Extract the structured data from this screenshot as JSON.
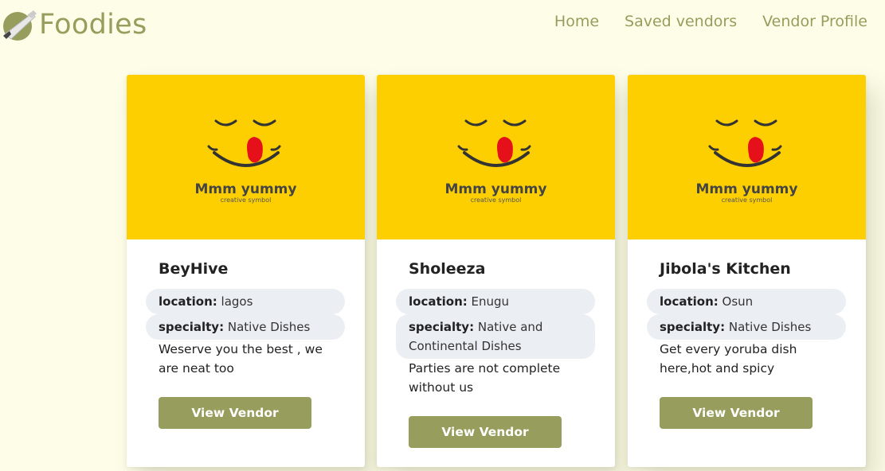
{
  "brand": {
    "name": "Foodies",
    "logo_icon": "rocket-icon"
  },
  "nav": {
    "links": [
      {
        "label": "Home"
      },
      {
        "label": "Saved vendors"
      },
      {
        "label": "Vendor Profile"
      }
    ]
  },
  "image_text": {
    "headline": "Mmm yummy",
    "tagline": "creative symbol"
  },
  "field_labels": {
    "location": "location:",
    "specialty": "specialty:"
  },
  "vendors": [
    {
      "name": "BeyHive",
      "location": "lagos",
      "specialty": "Native Dishes",
      "description": "Weserve you the best , we are neat too",
      "button_label": "View Vendor"
    },
    {
      "name": "Sholeeza",
      "location": "Enugu",
      "specialty": "Native and Continental Dishes",
      "description": "Parties are not complete without us",
      "button_label": "View Vendor"
    },
    {
      "name": "Jibola's Kitchen",
      "location": "Osun",
      "specialty": "Native Dishes",
      "description": "Get every yoruba dish here,hot and spicy",
      "button_label": "View Vendor"
    }
  ],
  "colors": {
    "page_bg": "#fdfde8",
    "accent": "#979d5c",
    "card_image_bg": "#fecf00",
    "pill_bg": "#ebeff3",
    "tongue": "#e5101a"
  }
}
